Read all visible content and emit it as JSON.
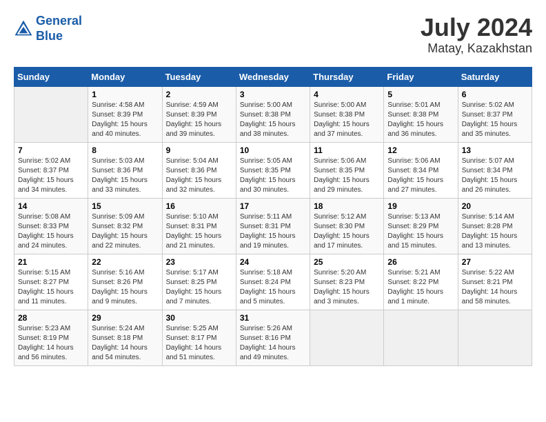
{
  "header": {
    "logo_line1": "General",
    "logo_line2": "Blue",
    "month_year": "July 2024",
    "location": "Matay, Kazakhstan"
  },
  "columns": [
    "Sunday",
    "Monday",
    "Tuesday",
    "Wednesday",
    "Thursday",
    "Friday",
    "Saturday"
  ],
  "weeks": [
    [
      {
        "day": "",
        "sunrise": "",
        "sunset": "",
        "daylight": ""
      },
      {
        "day": "1",
        "sunrise": "Sunrise: 4:58 AM",
        "sunset": "Sunset: 8:39 PM",
        "daylight": "Daylight: 15 hours and 40 minutes."
      },
      {
        "day": "2",
        "sunrise": "Sunrise: 4:59 AM",
        "sunset": "Sunset: 8:39 PM",
        "daylight": "Daylight: 15 hours and 39 minutes."
      },
      {
        "day": "3",
        "sunrise": "Sunrise: 5:00 AM",
        "sunset": "Sunset: 8:38 PM",
        "daylight": "Daylight: 15 hours and 38 minutes."
      },
      {
        "day": "4",
        "sunrise": "Sunrise: 5:00 AM",
        "sunset": "Sunset: 8:38 PM",
        "daylight": "Daylight: 15 hours and 37 minutes."
      },
      {
        "day": "5",
        "sunrise": "Sunrise: 5:01 AM",
        "sunset": "Sunset: 8:38 PM",
        "daylight": "Daylight: 15 hours and 36 minutes."
      },
      {
        "day": "6",
        "sunrise": "Sunrise: 5:02 AM",
        "sunset": "Sunset: 8:37 PM",
        "daylight": "Daylight: 15 hours and 35 minutes."
      }
    ],
    [
      {
        "day": "7",
        "sunrise": "Sunrise: 5:02 AM",
        "sunset": "Sunset: 8:37 PM",
        "daylight": "Daylight: 15 hours and 34 minutes."
      },
      {
        "day": "8",
        "sunrise": "Sunrise: 5:03 AM",
        "sunset": "Sunset: 8:36 PM",
        "daylight": "Daylight: 15 hours and 33 minutes."
      },
      {
        "day": "9",
        "sunrise": "Sunrise: 5:04 AM",
        "sunset": "Sunset: 8:36 PM",
        "daylight": "Daylight: 15 hours and 32 minutes."
      },
      {
        "day": "10",
        "sunrise": "Sunrise: 5:05 AM",
        "sunset": "Sunset: 8:35 PM",
        "daylight": "Daylight: 15 hours and 30 minutes."
      },
      {
        "day": "11",
        "sunrise": "Sunrise: 5:06 AM",
        "sunset": "Sunset: 8:35 PM",
        "daylight": "Daylight: 15 hours and 29 minutes."
      },
      {
        "day": "12",
        "sunrise": "Sunrise: 5:06 AM",
        "sunset": "Sunset: 8:34 PM",
        "daylight": "Daylight: 15 hours and 27 minutes."
      },
      {
        "day": "13",
        "sunrise": "Sunrise: 5:07 AM",
        "sunset": "Sunset: 8:34 PM",
        "daylight": "Daylight: 15 hours and 26 minutes."
      }
    ],
    [
      {
        "day": "14",
        "sunrise": "Sunrise: 5:08 AM",
        "sunset": "Sunset: 8:33 PM",
        "daylight": "Daylight: 15 hours and 24 minutes."
      },
      {
        "day": "15",
        "sunrise": "Sunrise: 5:09 AM",
        "sunset": "Sunset: 8:32 PM",
        "daylight": "Daylight: 15 hours and 22 minutes."
      },
      {
        "day": "16",
        "sunrise": "Sunrise: 5:10 AM",
        "sunset": "Sunset: 8:31 PM",
        "daylight": "Daylight: 15 hours and 21 minutes."
      },
      {
        "day": "17",
        "sunrise": "Sunrise: 5:11 AM",
        "sunset": "Sunset: 8:31 PM",
        "daylight": "Daylight: 15 hours and 19 minutes."
      },
      {
        "day": "18",
        "sunrise": "Sunrise: 5:12 AM",
        "sunset": "Sunset: 8:30 PM",
        "daylight": "Daylight: 15 hours and 17 minutes."
      },
      {
        "day": "19",
        "sunrise": "Sunrise: 5:13 AM",
        "sunset": "Sunset: 8:29 PM",
        "daylight": "Daylight: 15 hours and 15 minutes."
      },
      {
        "day": "20",
        "sunrise": "Sunrise: 5:14 AM",
        "sunset": "Sunset: 8:28 PM",
        "daylight": "Daylight: 15 hours and 13 minutes."
      }
    ],
    [
      {
        "day": "21",
        "sunrise": "Sunrise: 5:15 AM",
        "sunset": "Sunset: 8:27 PM",
        "daylight": "Daylight: 15 hours and 11 minutes."
      },
      {
        "day": "22",
        "sunrise": "Sunrise: 5:16 AM",
        "sunset": "Sunset: 8:26 PM",
        "daylight": "Daylight: 15 hours and 9 minutes."
      },
      {
        "day": "23",
        "sunrise": "Sunrise: 5:17 AM",
        "sunset": "Sunset: 8:25 PM",
        "daylight": "Daylight: 15 hours and 7 minutes."
      },
      {
        "day": "24",
        "sunrise": "Sunrise: 5:18 AM",
        "sunset": "Sunset: 8:24 PM",
        "daylight": "Daylight: 15 hours and 5 minutes."
      },
      {
        "day": "25",
        "sunrise": "Sunrise: 5:20 AM",
        "sunset": "Sunset: 8:23 PM",
        "daylight": "Daylight: 15 hours and 3 minutes."
      },
      {
        "day": "26",
        "sunrise": "Sunrise: 5:21 AM",
        "sunset": "Sunset: 8:22 PM",
        "daylight": "Daylight: 15 hours and 1 minute."
      },
      {
        "day": "27",
        "sunrise": "Sunrise: 5:22 AM",
        "sunset": "Sunset: 8:21 PM",
        "daylight": "Daylight: 14 hours and 58 minutes."
      }
    ],
    [
      {
        "day": "28",
        "sunrise": "Sunrise: 5:23 AM",
        "sunset": "Sunset: 8:19 PM",
        "daylight": "Daylight: 14 hours and 56 minutes."
      },
      {
        "day": "29",
        "sunrise": "Sunrise: 5:24 AM",
        "sunset": "Sunset: 8:18 PM",
        "daylight": "Daylight: 14 hours and 54 minutes."
      },
      {
        "day": "30",
        "sunrise": "Sunrise: 5:25 AM",
        "sunset": "Sunset: 8:17 PM",
        "daylight": "Daylight: 14 hours and 51 minutes."
      },
      {
        "day": "31",
        "sunrise": "Sunrise: 5:26 AM",
        "sunset": "Sunset: 8:16 PM",
        "daylight": "Daylight: 14 hours and 49 minutes."
      },
      {
        "day": "",
        "sunrise": "",
        "sunset": "",
        "daylight": ""
      },
      {
        "day": "",
        "sunrise": "",
        "sunset": "",
        "daylight": ""
      },
      {
        "day": "",
        "sunrise": "",
        "sunset": "",
        "daylight": ""
      }
    ]
  ]
}
